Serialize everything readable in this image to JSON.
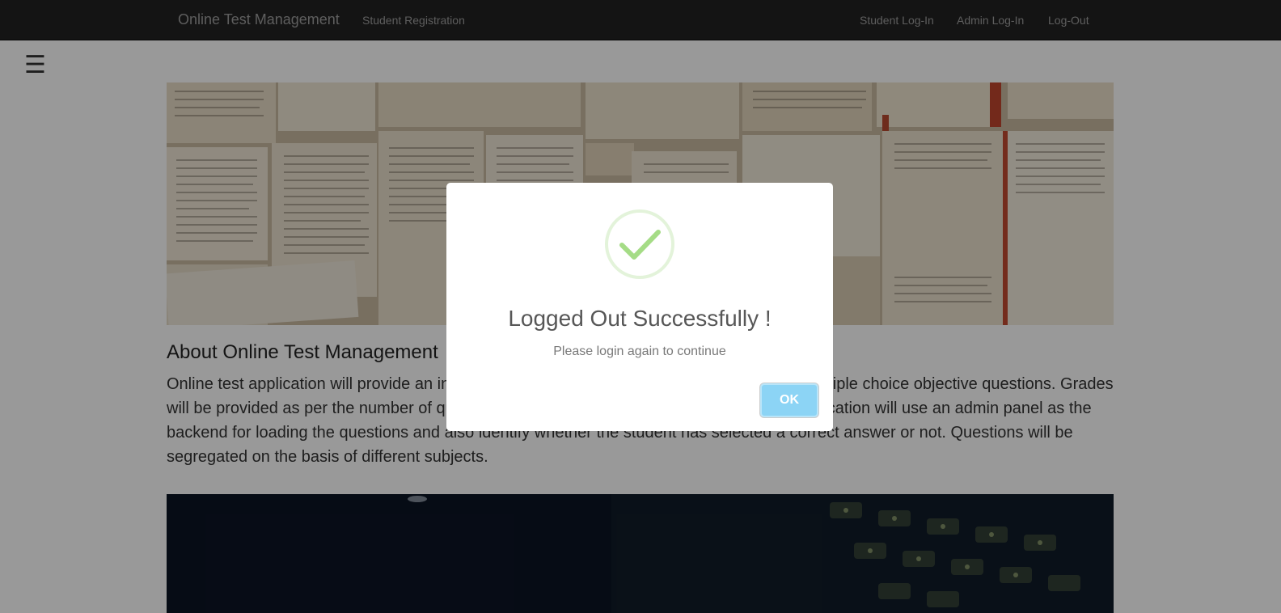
{
  "navbar": {
    "brand": "Online Test Management",
    "left_links": [
      {
        "label": "Student Registration"
      }
    ],
    "right_links": [
      {
        "label": "Student Log-In"
      },
      {
        "label": "Admin Log-In"
      },
      {
        "label": "Log-Out"
      }
    ]
  },
  "menu": {
    "hamburger": "☰"
  },
  "about": {
    "title": "About Online Test Management",
    "text": "Online test application will provide an interface for students to attempt tests consisting of multiple choice objective questions. Grades will be provided as per the number of questions answered correctly by the student. The application will use an admin panel as the backend for loading the questions and also identify whether the student has selected a correct answer or not. Questions will be segregated on the basis of different subjects."
  },
  "modal": {
    "icon": "success-check-icon",
    "title": "Logged Out Successfully !",
    "text": "Please login again to continue",
    "ok_label": "OK"
  },
  "colors": {
    "navbar_bg": "#222222",
    "nav_text": "#9d9d9d",
    "ok_button": "#8cd4f5",
    "success_green": "#a5dc86"
  }
}
